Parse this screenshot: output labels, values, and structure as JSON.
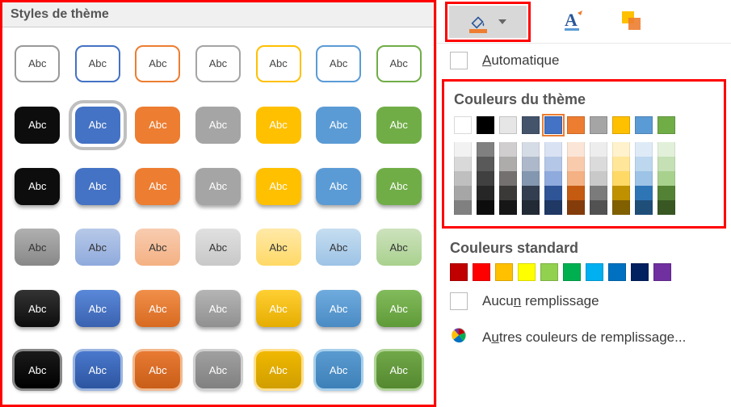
{
  "left": {
    "header": "Styles de thème",
    "swatch_label": "Abc",
    "selected_index": 8,
    "rows": [
      [
        {
          "bg": "#ffffff",
          "fg": "#444",
          "border": "2px solid #999"
        },
        {
          "bg": "#ffffff",
          "fg": "#444",
          "border": "2px solid #4472c4"
        },
        {
          "bg": "#ffffff",
          "fg": "#444",
          "border": "2px solid #ed7d31"
        },
        {
          "bg": "#ffffff",
          "fg": "#444",
          "border": "2px solid #a5a5a5"
        },
        {
          "bg": "#ffffff",
          "fg": "#444",
          "border": "2px solid #ffc000"
        },
        {
          "bg": "#ffffff",
          "fg": "#444",
          "border": "2px solid #5b9bd5"
        },
        {
          "bg": "#ffffff",
          "fg": "#444",
          "border": "2px solid #70ad47"
        }
      ],
      [
        {
          "bg": "#0d0d0d",
          "fg": "#fff",
          "border": "none"
        },
        {
          "bg": "#4472c4",
          "fg": "#fff",
          "border": "none"
        },
        {
          "bg": "#ed7d31",
          "fg": "#fff",
          "border": "none"
        },
        {
          "bg": "#a5a5a5",
          "fg": "#fff",
          "border": "none"
        },
        {
          "bg": "#ffc000",
          "fg": "#fff",
          "border": "none"
        },
        {
          "bg": "#5b9bd5",
          "fg": "#fff",
          "border": "none"
        },
        {
          "bg": "#70ad47",
          "fg": "#fff",
          "border": "none"
        }
      ],
      [
        {
          "bg": "#0d0d0d",
          "fg": "#fff",
          "border": "none",
          "shadow": true
        },
        {
          "bg": "#4472c4",
          "fg": "#fff",
          "border": "none",
          "shadow": true
        },
        {
          "bg": "#ed7d31",
          "fg": "#fff",
          "border": "none",
          "shadow": true
        },
        {
          "bg": "#a5a5a5",
          "fg": "#fff",
          "border": "none",
          "shadow": true
        },
        {
          "bg": "#ffc000",
          "fg": "#fff",
          "border": "none",
          "shadow": true
        },
        {
          "bg": "#5b9bd5",
          "fg": "#fff",
          "border": "none",
          "shadow": true
        },
        {
          "bg": "#70ad47",
          "fg": "#fff",
          "border": "none",
          "shadow": true
        }
      ],
      [
        {
          "bg": "linear-gradient(#b0b0b0,#888)",
          "fg": "#333",
          "border": "none"
        },
        {
          "bg": "linear-gradient(#b7c9e8,#8faadc)",
          "fg": "#333",
          "border": "none"
        },
        {
          "bg": "linear-gradient(#f8ccb0,#f4b183)",
          "fg": "#333",
          "border": "none"
        },
        {
          "bg": "linear-gradient(#e0e0e0,#c8c8c8)",
          "fg": "#333",
          "border": "none"
        },
        {
          "bg": "linear-gradient(#ffe9a8,#ffd966)",
          "fg": "#333",
          "border": "none"
        },
        {
          "bg": "linear-gradient(#c5ddf0,#9dc3e6)",
          "fg": "#333",
          "border": "none"
        },
        {
          "bg": "linear-gradient(#cde2bd,#a9d18e)",
          "fg": "#333",
          "border": "none"
        }
      ],
      [
        {
          "bg": "linear-gradient(#333,#0d0d0d)",
          "fg": "#fff",
          "border": "none",
          "shadow": true
        },
        {
          "bg": "linear-gradient(#5a88d8,#3a62b0)",
          "fg": "#fff",
          "border": "none",
          "shadow": true
        },
        {
          "bg": "linear-gradient(#f08f4a,#d86a20)",
          "fg": "#fff",
          "border": "none",
          "shadow": true
        },
        {
          "bg": "linear-gradient(#b5b5b5,#909090)",
          "fg": "#fff",
          "border": "none",
          "shadow": true
        },
        {
          "bg": "linear-gradient(#ffcf33,#e6ad00)",
          "fg": "#fff",
          "border": "none",
          "shadow": true
        },
        {
          "bg": "linear-gradient(#6fabde,#4a8bc4)",
          "fg": "#fff",
          "border": "none",
          "shadow": true
        },
        {
          "bg": "linear-gradient(#82bb5b,#5f9a38)",
          "fg": "#fff",
          "border": "none",
          "shadow": true
        }
      ],
      [
        {
          "bg": "linear-gradient(#1a1a1a,#000)",
          "fg": "#fff",
          "border": "none",
          "shadow": true,
          "glow": "#888"
        },
        {
          "bg": "linear-gradient(#4a78cc,#2d55a0)",
          "fg": "#fff",
          "border": "none",
          "shadow": true,
          "glow": "#9ab5e0"
        },
        {
          "bg": "linear-gradient(#e87a33,#c85e18)",
          "fg": "#fff",
          "border": "none",
          "shadow": true,
          "glow": "#f2b98f"
        },
        {
          "bg": "linear-gradient(#a0a0a0,#808080)",
          "fg": "#fff",
          "border": "none",
          "shadow": true,
          "glow": "#d0d0d0"
        },
        {
          "bg": "linear-gradient(#f0b800,#d09e00)",
          "fg": "#fff",
          "border": "none",
          "shadow": true,
          "glow": "#ffe090"
        },
        {
          "bg": "linear-gradient(#5a9bd0,#3d80b8)",
          "fg": "#fff",
          "border": "none",
          "shadow": true,
          "glow": "#a8d0ec"
        },
        {
          "bg": "linear-gradient(#70a848,#558830)",
          "fg": "#fff",
          "border": "none",
          "shadow": true,
          "glow": "#b0d498"
        }
      ]
    ]
  },
  "right": {
    "automatic_label_pre": "A",
    "automatic_label_post": "utomatique",
    "theme_colors_header": "Couleurs du thème",
    "standard_colors_header": "Couleurs standard",
    "nofill_pre": "Aucu",
    "nofill_u": "n",
    "nofill_post": " remplissage",
    "more_pre": "A",
    "more_u": "u",
    "more_post": "tres couleurs de remplissage...",
    "accent_selected_index": 4,
    "theme_accents": [
      "#ffffff",
      "#000000",
      "#e7e6e6",
      "#44546a",
      "#4472c4",
      "#ed7d31",
      "#a5a5a5",
      "#ffc000",
      "#5b9bd5",
      "#70ad47"
    ],
    "theme_shades": [
      [
        "#f2f2f2",
        "#d9d9d9",
        "#bfbfbf",
        "#a6a6a6",
        "#808080"
      ],
      [
        "#808080",
        "#595959",
        "#404040",
        "#262626",
        "#0d0d0d"
      ],
      [
        "#d0cece",
        "#aeabab",
        "#757070",
        "#3b3838",
        "#171616"
      ],
      [
        "#d6dce5",
        "#adb9ca",
        "#8497b0",
        "#333f50",
        "#222a35"
      ],
      [
        "#d9e2f3",
        "#b4c7e7",
        "#8faadc",
        "#2f5597",
        "#1f3864"
      ],
      [
        "#fbe5d6",
        "#f8cbad",
        "#f4b183",
        "#c55a11",
        "#843c0b"
      ],
      [
        "#ededed",
        "#dbdbdb",
        "#c9c9c9",
        "#7b7b7b",
        "#525252"
      ],
      [
        "#fff2cc",
        "#ffe699",
        "#ffd966",
        "#bf9000",
        "#806000"
      ],
      [
        "#deebf7",
        "#bdd7ee",
        "#9dc3e6",
        "#2e75b6",
        "#1f4e79"
      ],
      [
        "#e2f0d9",
        "#c5e0b4",
        "#a9d18e",
        "#548235",
        "#385723"
      ]
    ],
    "standard_colors": [
      "#c00000",
      "#ff0000",
      "#ffc000",
      "#ffff00",
      "#92d050",
      "#00b050",
      "#00b0f0",
      "#0070c0",
      "#002060",
      "#7030a0"
    ]
  }
}
